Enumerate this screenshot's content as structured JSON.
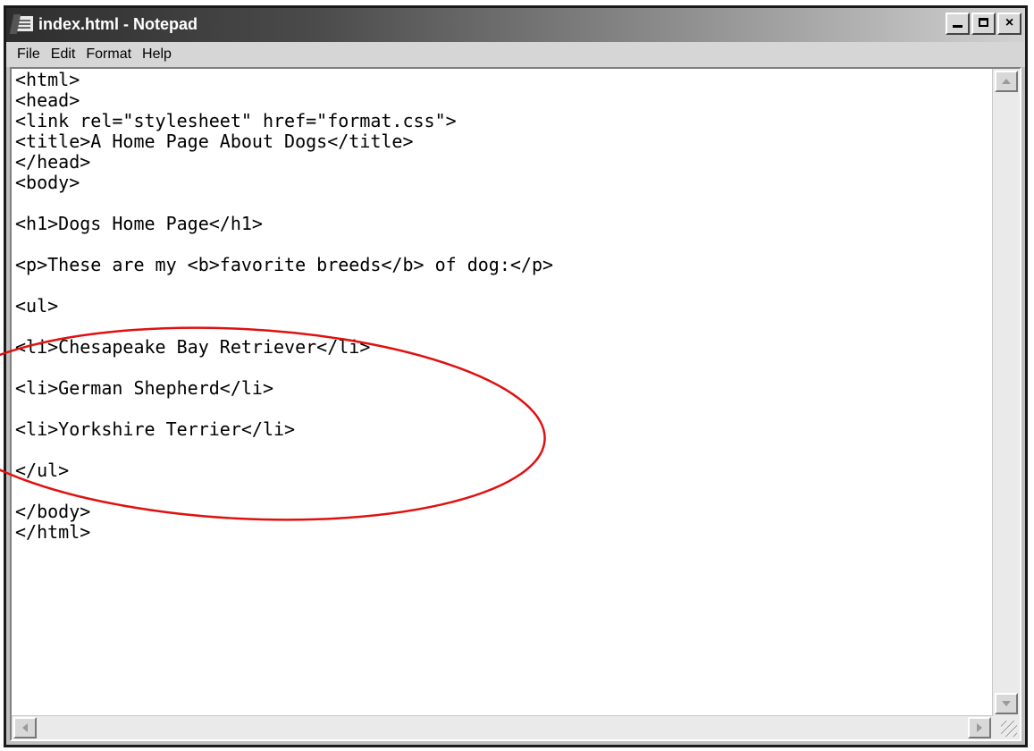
{
  "window": {
    "title": "index.html - Notepad",
    "app_icon": "notepad-icon",
    "controls": {
      "minimize": "minimize-icon",
      "maximize": "maximize-icon",
      "close_label": "×"
    }
  },
  "menu": {
    "items": [
      "File",
      "Edit",
      "Format",
      "Help"
    ]
  },
  "editor": {
    "lines": [
      "<html>",
      "<head>",
      "<link rel=\"stylesheet\" href=\"format.css\">",
      "<title>A Home Page About Dogs</title>",
      "</head>",
      "<body>",
      "",
      "<h1>Dogs Home Page</h1>",
      "",
      "<p>These are my <b>favorite breeds</b> of dog:</p>",
      "",
      "<ul>",
      "",
      "<li>Chesapeake Bay Retriever</li>",
      "",
      "<li>German Shepherd</li>",
      "",
      "<li>Yorkshire Terrier</li>",
      "",
      "</ul>",
      "",
      "</body>",
      "</html>"
    ]
  },
  "annotation": {
    "shape": "ellipse",
    "color": "#e01010"
  },
  "icons": {
    "scroll_up": "arrow-up-icon",
    "scroll_down": "arrow-down-icon",
    "scroll_left": "arrow-left-icon",
    "scroll_right": "arrow-right-icon",
    "resize": "resize-grip-icon"
  }
}
